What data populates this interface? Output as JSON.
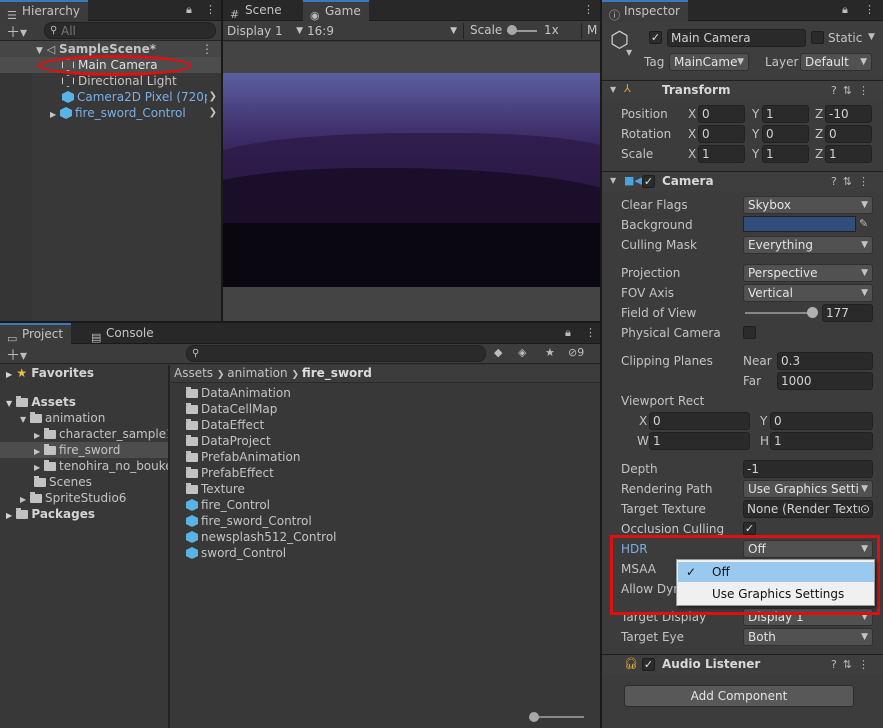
{
  "hierarchy": {
    "tab_label": "Hierarchy",
    "search_placeholder": "All",
    "scene": "SampleScene*",
    "items": [
      "Main Camera",
      "Directional Light",
      "Camera2D Pixel (720p",
      "fire_sword_Control"
    ]
  },
  "game_view": {
    "tab_scene": "Scene",
    "tab_game": "Game",
    "display": "Display 1",
    "aspect": "16:9",
    "scale_label": "Scale",
    "scale_value": "1x",
    "extra": "M"
  },
  "project": {
    "tab_project": "Project",
    "tab_console": "Console",
    "badge_count": "9",
    "favorites": "Favorites",
    "tree": [
      "Assets",
      "animation",
      "character_sample1",
      "fire_sword",
      "tenohira_no_bouke",
      "Scenes",
      "SpriteStudio6",
      "Packages"
    ],
    "breadcrumb": [
      "Assets",
      "animation",
      "fire_sword"
    ],
    "files": [
      "DataAnimation",
      "DataCellMap",
      "DataEffect",
      "DataProject",
      "PrefabAnimation",
      "PrefabEffect",
      "Texture",
      "fire_Control",
      "fire_sword_Control",
      "newsplash512_Control",
      "sword_Control"
    ]
  },
  "inspector": {
    "tab_label": "Inspector",
    "object_name": "Main Camera",
    "static_label": "Static",
    "tag_label": "Tag",
    "tag_value": "MainCame",
    "layer_label": "Layer",
    "layer_value": "Default",
    "transform": {
      "title": "Transform",
      "position_label": "Position",
      "rotation_label": "Rotation",
      "scale_label": "Scale",
      "axis_x": "X",
      "axis_y": "Y",
      "axis_z": "Z",
      "position": [
        "0",
        "1",
        "-10"
      ],
      "rotation": [
        "0",
        "0",
        "0"
      ],
      "scale": [
        "1",
        "1",
        "1"
      ]
    },
    "camera": {
      "title": "Camera",
      "clear_flags_label": "Clear Flags",
      "clear_flags": "Skybox",
      "background_label": "Background",
      "background_color": "#314d79",
      "culling_mask_label": "Culling Mask",
      "culling_mask": "Everything",
      "projection_label": "Projection",
      "projection": "Perspective",
      "fov_axis_label": "FOV Axis",
      "fov_axis": "Vertical",
      "fov_label": "Field of View",
      "fov": "177",
      "physical_label": "Physical Camera",
      "clipping_label": "Clipping Planes",
      "near_label": "Near",
      "near": "0.3",
      "far_label": "Far",
      "far": "1000",
      "viewport_label": "Viewport Rect",
      "vp_x_label": "X",
      "vp_x": "0",
      "vp_y_label": "Y",
      "vp_y": "0",
      "vp_w_label": "W",
      "vp_w": "1",
      "vp_h_label": "H",
      "vp_h": "1",
      "depth_label": "Depth",
      "depth": "-1",
      "rendering_path_label": "Rendering Path",
      "rendering_path": "Use Graphics Settin",
      "target_texture_label": "Target Texture",
      "target_texture": "None (Render Textu",
      "occlusion_label": "Occlusion Culling",
      "hdr_label": "HDR",
      "hdr": "Off",
      "msaa_label": "MSAA",
      "allow_dyn_label": "Allow Dyn",
      "target_display_label": "Target Display",
      "target_display": "Display 1",
      "target_eye_label": "Target Eye",
      "target_eye": "Both"
    },
    "audio_listener": "Audio Listener",
    "add_component": "Add Component"
  },
  "hdr_dropdown": {
    "options": [
      "Off",
      "Use Graphics Settings"
    ],
    "selected": "Off"
  },
  "colors": {
    "accent": "#3a79bb",
    "annotation_red": "#e01010",
    "selected_row": "#4d4d4d"
  }
}
